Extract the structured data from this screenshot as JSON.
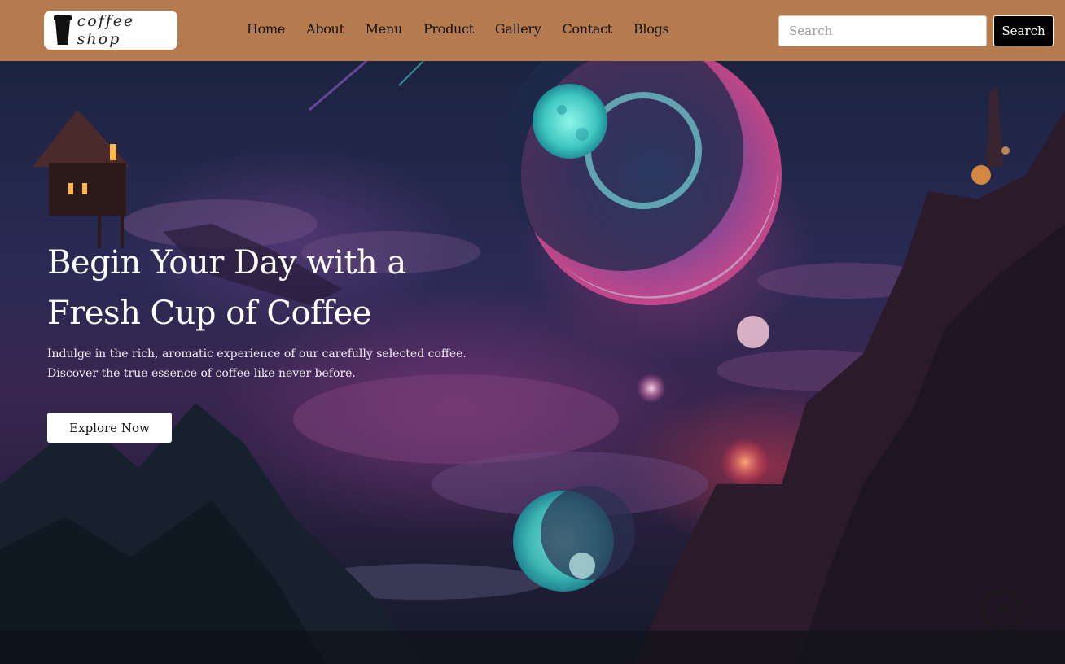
{
  "brand": {
    "logo_text": "coffee shop",
    "icon": "coffee-cup-icon"
  },
  "nav": {
    "links": [
      "Home",
      "About",
      "Menu",
      "Product",
      "Gallery",
      "Contact",
      "Blogs"
    ]
  },
  "search": {
    "placeholder": "Search",
    "button_label": "Search"
  },
  "hero": {
    "title_line1": "Begin Your Day with a",
    "title_line2": "Fresh Cup of Coffee",
    "desc_line1": "Indulge in the rich, aromatic experience of our carefully selected coffee.",
    "desc_line2": "Discover the true essence of coffee like never before.",
    "cta_label": "Explore Now"
  },
  "scroll_top": {
    "icon": "chevron-up-icon"
  },
  "colors": {
    "navbar": "#b67a4f",
    "button_dark": "#000000"
  }
}
